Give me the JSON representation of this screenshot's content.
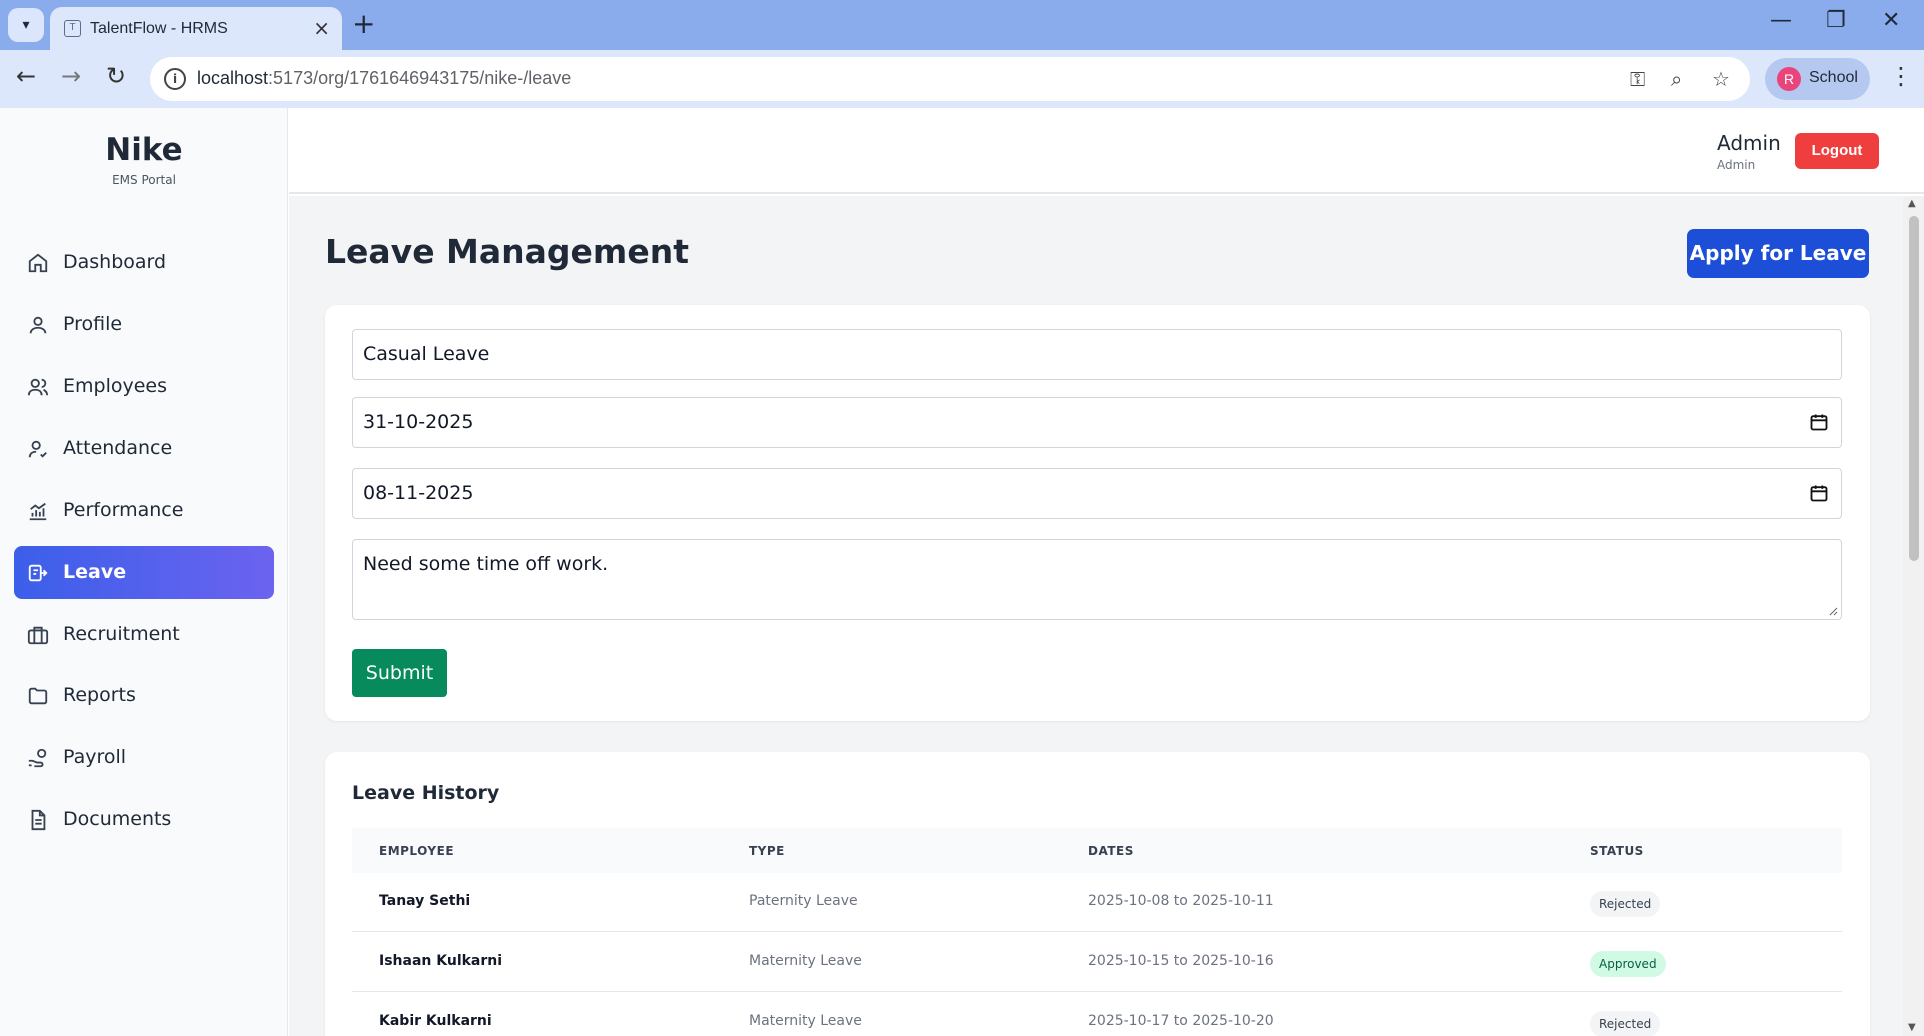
{
  "browser": {
    "tab_title": "TalentFlow - HRMS",
    "tab_favicon_letter": "T",
    "url_host": "localhost",
    "url_rest": ":5173/org/1761646943175/nike-/leave",
    "profile_initial": "R",
    "profile_label": "School"
  },
  "sidebar": {
    "brand": "Nike",
    "brand_sub": "EMS Portal",
    "items": [
      {
        "label": "Dashboard",
        "icon": "home-icon"
      },
      {
        "label": "Profile",
        "icon": "user-icon"
      },
      {
        "label": "Employees",
        "icon": "users-icon"
      },
      {
        "label": "Attendance",
        "icon": "user-check-icon"
      },
      {
        "label": "Performance",
        "icon": "chart-icon"
      },
      {
        "label": "Leave",
        "icon": "leave-icon",
        "active": true
      },
      {
        "label": "Recruitment",
        "icon": "briefcase-icon"
      },
      {
        "label": "Reports",
        "icon": "folder-icon"
      },
      {
        "label": "Payroll",
        "icon": "hand-coins-icon"
      },
      {
        "label": "Documents",
        "icon": "document-icon"
      }
    ]
  },
  "header": {
    "user_name": "Admin",
    "user_role": "Admin",
    "logout_label": "Logout"
  },
  "page": {
    "title": "Leave Management",
    "apply_label": "Apply for Leave"
  },
  "form": {
    "leave_type": "Casual Leave",
    "start_date": "31-10-2025",
    "end_date": "08-11-2025",
    "reason": "Need some time off work.",
    "submit_label": "Submit"
  },
  "history": {
    "title": "Leave History",
    "columns": [
      "EMPLOYEE",
      "TYPE",
      "DATES",
      "STATUS"
    ],
    "rows": [
      {
        "employee": "Tanay Sethi",
        "type": "Paternity Leave",
        "dates": "2025-10-08 to 2025-10-11",
        "status": "Rejected"
      },
      {
        "employee": "Ishaan Kulkarni",
        "type": "Maternity Leave",
        "dates": "2025-10-15 to 2025-10-16",
        "status": "Approved"
      },
      {
        "employee": "Kabir Kulkarni",
        "type": "Maternity Leave",
        "dates": "2025-10-17 to 2025-10-20",
        "status": "Rejected"
      }
    ]
  },
  "colors": {
    "primary": "#1d4ed8",
    "logout": "#ef3e3e",
    "submit": "#078a5c",
    "approved_bg": "#d1fae5"
  }
}
